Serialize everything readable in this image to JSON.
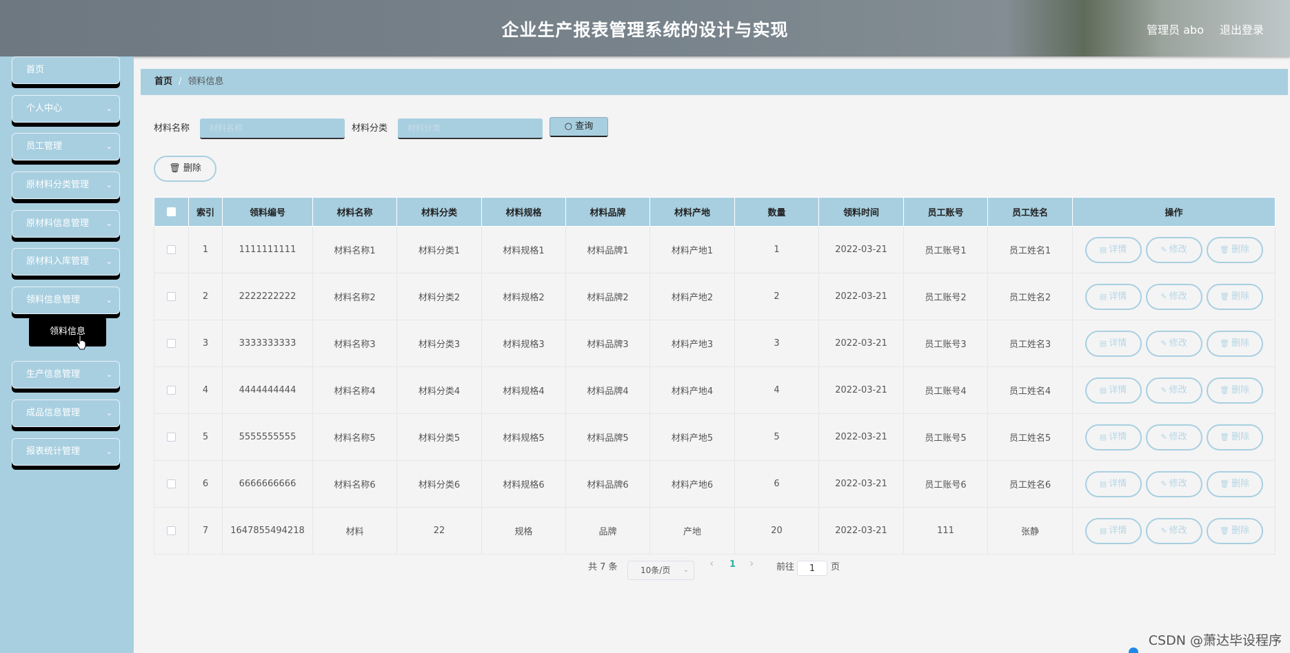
{
  "header": {
    "title": "企业生产报表管理系统的设计与实现",
    "user": "管理员 abo",
    "logout": "退出登录"
  },
  "sidebar": {
    "items": [
      {
        "label": "首页"
      },
      {
        "label": "个人中心"
      },
      {
        "label": "员工管理"
      },
      {
        "label": "原材料分类管理"
      },
      {
        "label": "原材料信息管理"
      },
      {
        "label": "原材料入库管理"
      },
      {
        "label": "领料信息管理"
      },
      {
        "label": "生产信息管理"
      },
      {
        "label": "成品信息管理"
      },
      {
        "label": "报表统计管理"
      }
    ],
    "active_sub": "领料信息"
  },
  "breadcrumb": {
    "home": "首页",
    "sep": "/",
    "current": "领料信息"
  },
  "search": {
    "name_label": "材料名称",
    "name_placeholder": "材料名称",
    "category_label": "材料分类",
    "category_placeholder": "材料分类",
    "query_button": "查询"
  },
  "toolbar": {
    "delete_label": "删除"
  },
  "table": {
    "headers": [
      "索引",
      "领料编号",
      "材料名称",
      "材料分类",
      "材料规格",
      "材料品牌",
      "材料产地",
      "数量",
      "领料时间",
      "员工账号",
      "员工姓名",
      "操作"
    ],
    "rows": [
      [
        "1",
        "1111111111",
        "材料名称1",
        "材料分类1",
        "材料规格1",
        "材料品牌1",
        "材料产地1",
        "1",
        "2022-03-21",
        "员工账号1",
        "员工姓名1"
      ],
      [
        "2",
        "2222222222",
        "材料名称2",
        "材料分类2",
        "材料规格2",
        "材料品牌2",
        "材料产地2",
        "2",
        "2022-03-21",
        "员工账号2",
        "员工姓名2"
      ],
      [
        "3",
        "3333333333",
        "材料名称3",
        "材料分类3",
        "材料规格3",
        "材料品牌3",
        "材料产地3",
        "3",
        "2022-03-21",
        "员工账号3",
        "员工姓名3"
      ],
      [
        "4",
        "4444444444",
        "材料名称4",
        "材料分类4",
        "材料规格4",
        "材料品牌4",
        "材料产地4",
        "4",
        "2022-03-21",
        "员工账号4",
        "员工姓名4"
      ],
      [
        "5",
        "5555555555",
        "材料名称5",
        "材料分类5",
        "材料规格5",
        "材料品牌5",
        "材料产地5",
        "5",
        "2022-03-21",
        "员工账号5",
        "员工姓名5"
      ],
      [
        "6",
        "6666666666",
        "材料名称6",
        "材料分类6",
        "材料规格6",
        "材料品牌6",
        "材料产地6",
        "6",
        "2022-03-21",
        "员工账号6",
        "员工姓名6"
      ],
      [
        "7",
        "1647855494218",
        "材料",
        "22",
        "规格",
        "品牌",
        "产地",
        "20",
        "2022-03-21",
        "111",
        "张静"
      ]
    ],
    "actions": [
      "详情",
      "修改",
      "删除"
    ]
  },
  "pagination": {
    "total": "共 7 条",
    "page_size": "10条/页",
    "current_page": "1",
    "goto_label": "前往",
    "goto_value": "1",
    "page_suffix": "页",
    "prev": "‹",
    "next": "›"
  },
  "watermark": "CSDN @萧达毕设程序",
  "colors": {
    "accent": "#a8cfe0",
    "active_page": "#2bb5a0"
  }
}
